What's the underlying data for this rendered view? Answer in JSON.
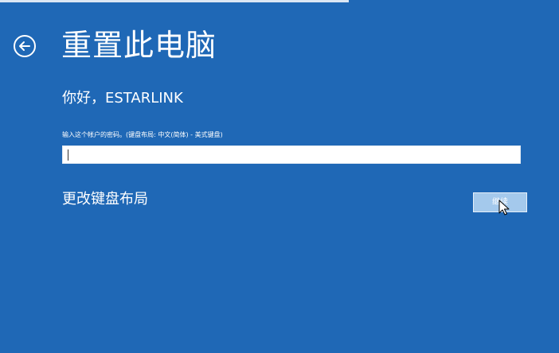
{
  "page": {
    "title": "重置此电脑",
    "greeting": "你好，ESTARLINK"
  },
  "password": {
    "label": "输入这个帐户的密码。(键盘布局: 中文(简体) - 美式键盘)",
    "value": ""
  },
  "links": {
    "change_keyboard": "更改键盘布局"
  },
  "buttons": {
    "continue": "继续"
  },
  "icons": {
    "back": "back-arrow-circle-icon",
    "cursor": "mouse-pointer-icon"
  },
  "colors": {
    "background": "#1f68b6",
    "button": "#a4c9ec",
    "text": "#ffffff"
  }
}
